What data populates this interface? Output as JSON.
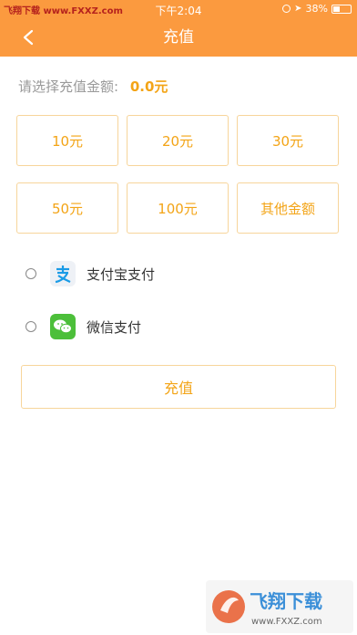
{
  "status_bar": {
    "carrier": "飞翔下载 www.FXXZ.com",
    "time": "下午2:04",
    "battery": "38%"
  },
  "nav": {
    "title": "充值"
  },
  "amount": {
    "label": "请选择充值金额:",
    "value": "0.0元"
  },
  "options": [
    {
      "label": "10元"
    },
    {
      "label": "20元"
    },
    {
      "label": "30元"
    },
    {
      "label": "50元"
    },
    {
      "label": "100元"
    },
    {
      "label": "其他金额"
    }
  ],
  "payment": {
    "alipay_label": "支付宝支付",
    "wechat_label": "微信支付"
  },
  "submit_label": "充值",
  "watermark": {
    "title": "飞翔下载",
    "url": "www.FXXZ.com"
  },
  "colors": {
    "accent": "#fb9a3f",
    "amount_text": "#f3a416",
    "border": "#f7d59b",
    "alipay_blue": "#1a9be6",
    "wechat_green": "#4cbf3a"
  },
  "icons": {
    "back": "chevron-left-icon",
    "alipay": "alipay-icon",
    "wechat": "wechat-icon"
  }
}
